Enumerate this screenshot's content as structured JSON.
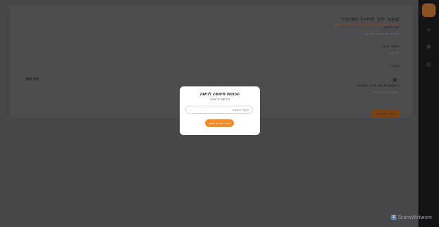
{
  "colors": {
    "accent": "#f28a30",
    "overlay": "#4a4a4c",
    "sidebar": "#141417",
    "modal_bg": "#ffffff"
  },
  "background_page": {
    "title": "קיצור דרך לניהול המכשיר",
    "subtitle": "הזן את פרטי הכניסה של ספק השירות כדי להמשיך",
    "fields": [
      {
        "label": "סוג הספק",
        "value": "הזן את שם הספק או החברה"
      },
      {
        "label": "מספר חוזה",
        "value": "לא זמין"
      },
      {
        "label": "מחיר",
        "value": ""
      },
      {
        "label": "התקשרות עם ספק השירות",
        "value": "כתובת מייל או טלפון"
      }
    ],
    "left_label": "₪0.00",
    "action_button": "המשך לשלב הבא"
  },
  "sidebar": {
    "icons": [
      "menu-icon",
      "user-icon",
      "document-icon",
      "settings-icon"
    ]
  },
  "watermark": {
    "logo_letter": "S",
    "text": "ScamWatware"
  },
  "modal": {
    "title": "הכנסת סיסמה לגישה",
    "subtitle": "נדרשת הרשאה",
    "input_placeholder": "הקלד סיסמה",
    "input_value": "",
    "submit_label": "אישור וכניסה לאתר"
  }
}
